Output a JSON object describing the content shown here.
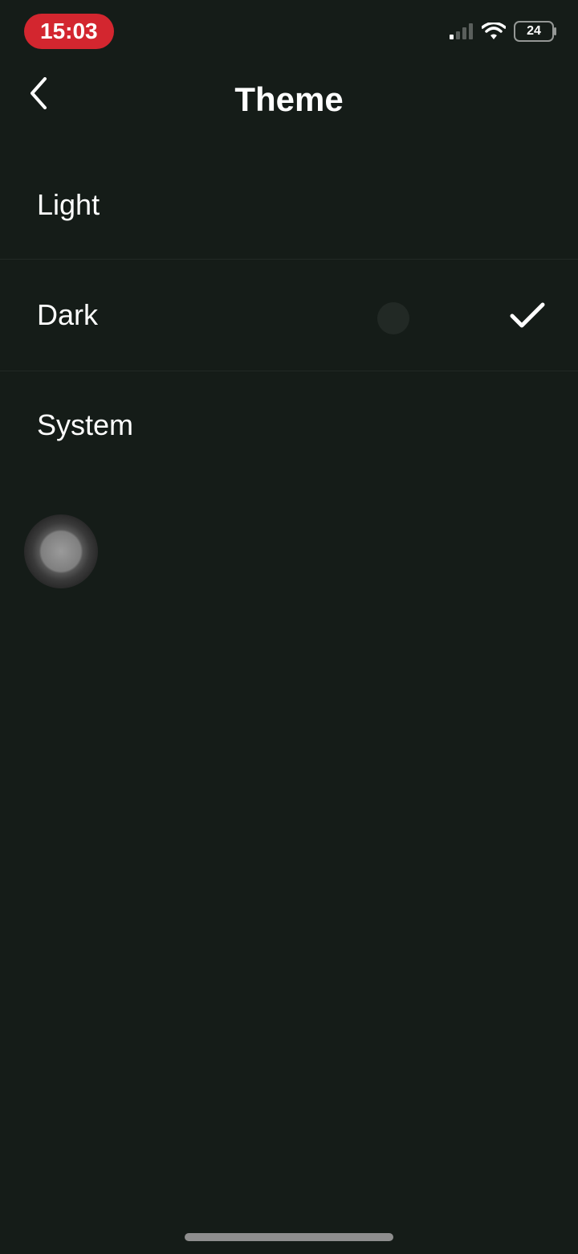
{
  "status_bar": {
    "time": "15:03",
    "battery_text": "24"
  },
  "header": {
    "title": "Theme"
  },
  "options": [
    {
      "label": "Light",
      "selected": false
    },
    {
      "label": "Dark",
      "selected": true
    },
    {
      "label": "System",
      "selected": false
    }
  ]
}
